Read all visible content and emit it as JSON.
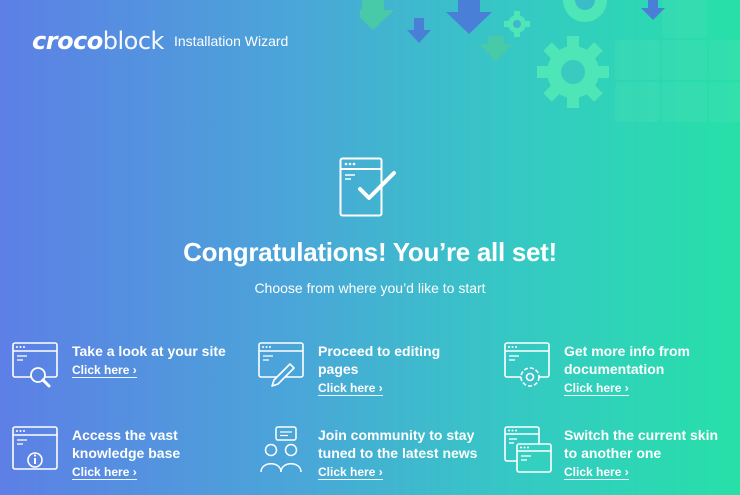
{
  "header": {
    "logo_bold": "croco",
    "logo_light": "block",
    "wizard_title": "Installation Wizard"
  },
  "main": {
    "title": "Congratulations! You’re all set!",
    "subtitle": "Choose from where you’d like to start"
  },
  "cards": [
    {
      "label": "Take a look at your site",
      "link": "Click here ›",
      "icon": "browser-search-icon"
    },
    {
      "label": "Proceed to editing pages",
      "link": "Click here ›",
      "icon": "browser-edit-icon"
    },
    {
      "label": "Get more info from documentation",
      "link": "Click here ›",
      "icon": "browser-gear-icon"
    },
    {
      "label": "Access the vast knowledge base",
      "link": "Click here ›",
      "icon": "browser-info-icon"
    },
    {
      "label": "Join community to stay tuned to the latest news",
      "link": "Click here ›",
      "icon": "community-icon"
    },
    {
      "label": "Switch the current skin to another one",
      "link": "Click here ›",
      "icon": "browser-skin-icon"
    }
  ],
  "colors": {
    "gradient_start": "#5d7fe6",
    "gradient_end": "#27e0a8",
    "decor_green": "#3de0b0",
    "decor_blue": "#4d82d8"
  }
}
